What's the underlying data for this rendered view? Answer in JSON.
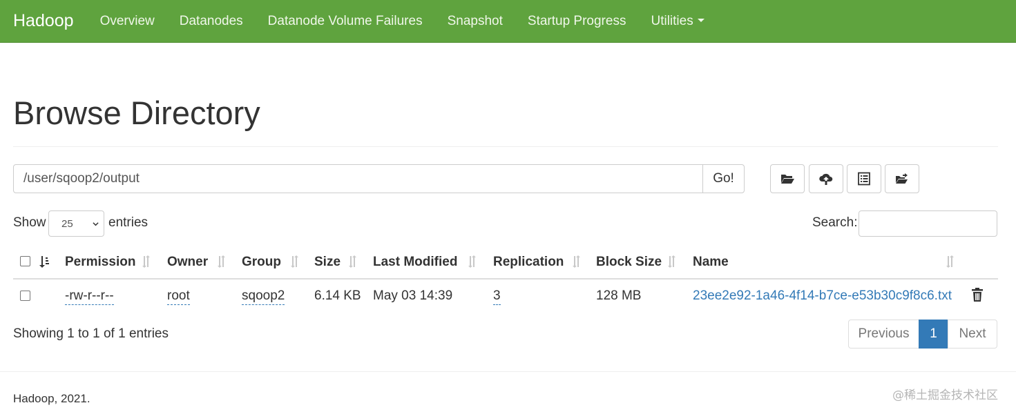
{
  "navbar": {
    "brand": "Hadoop",
    "items": [
      "Overview",
      "Datanodes",
      "Datanode Volume Failures",
      "Snapshot",
      "Startup Progress",
      "Utilities"
    ],
    "background_color": "#5fa33e"
  },
  "page": {
    "title": "Browse Directory"
  },
  "path_bar": {
    "value": "/user/sqoop2/output",
    "go_label": "Go!"
  },
  "toolbar": {
    "icons": [
      "folder-open-icon",
      "cloud-upload-icon",
      "list-alt-icon",
      "folder-move-icon"
    ]
  },
  "table_controls": {
    "show_label": "Show",
    "page_length": "25",
    "entries_label": "entries",
    "search_label": "Search:",
    "search_value": ""
  },
  "table": {
    "columns": [
      "Permission",
      "Owner",
      "Group",
      "Size",
      "Last Modified",
      "Replication",
      "Block Size",
      "Name"
    ],
    "rows": [
      {
        "permission": "-rw-r--r--",
        "owner": "root",
        "group": "sqoop2",
        "size": "6.14 KB",
        "last_modified": "May 03 14:39",
        "replication": "3",
        "block_size": "128 MB",
        "name": "23ee2e92-1a46-4f14-b7ce-e53b30c9f8c6.txt"
      }
    ]
  },
  "table_info": "Showing 1 to 1 of 1 entries",
  "pagination": {
    "previous": "Previous",
    "current": "1",
    "next": "Next",
    "active_color": "#337ab7"
  },
  "footer": {
    "text": "Hadoop, 2021."
  },
  "watermark": "@稀土掘金技术社区"
}
